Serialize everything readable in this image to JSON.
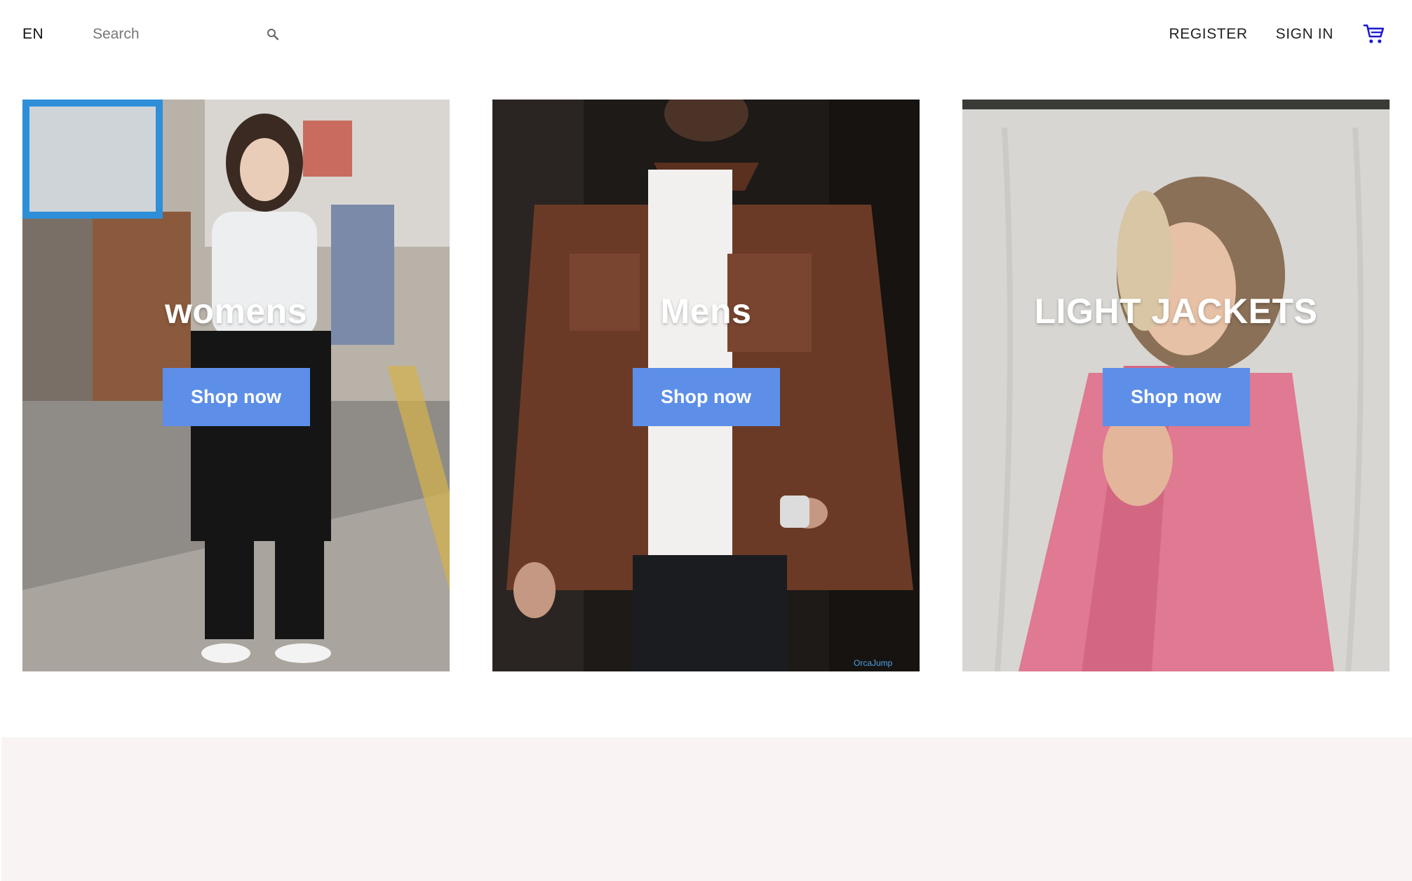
{
  "nav": {
    "lang": "EN",
    "search_placeholder": "Search",
    "search_icon": "search-icon",
    "register": "REGISTER",
    "sign_in": "SIGN IN",
    "cart_icon": "shopping-cart-icon"
  },
  "categories": [
    {
      "title": "womens",
      "button": "Shop now"
    },
    {
      "title": "Mens",
      "button": "Shop now"
    },
    {
      "title": "LIGHT JACKETS",
      "button": "Shop now"
    }
  ],
  "colors": {
    "button": "#5d8fe8",
    "cart_icon": "#1a1ad0",
    "bottom_band": "#f9f4f3"
  }
}
